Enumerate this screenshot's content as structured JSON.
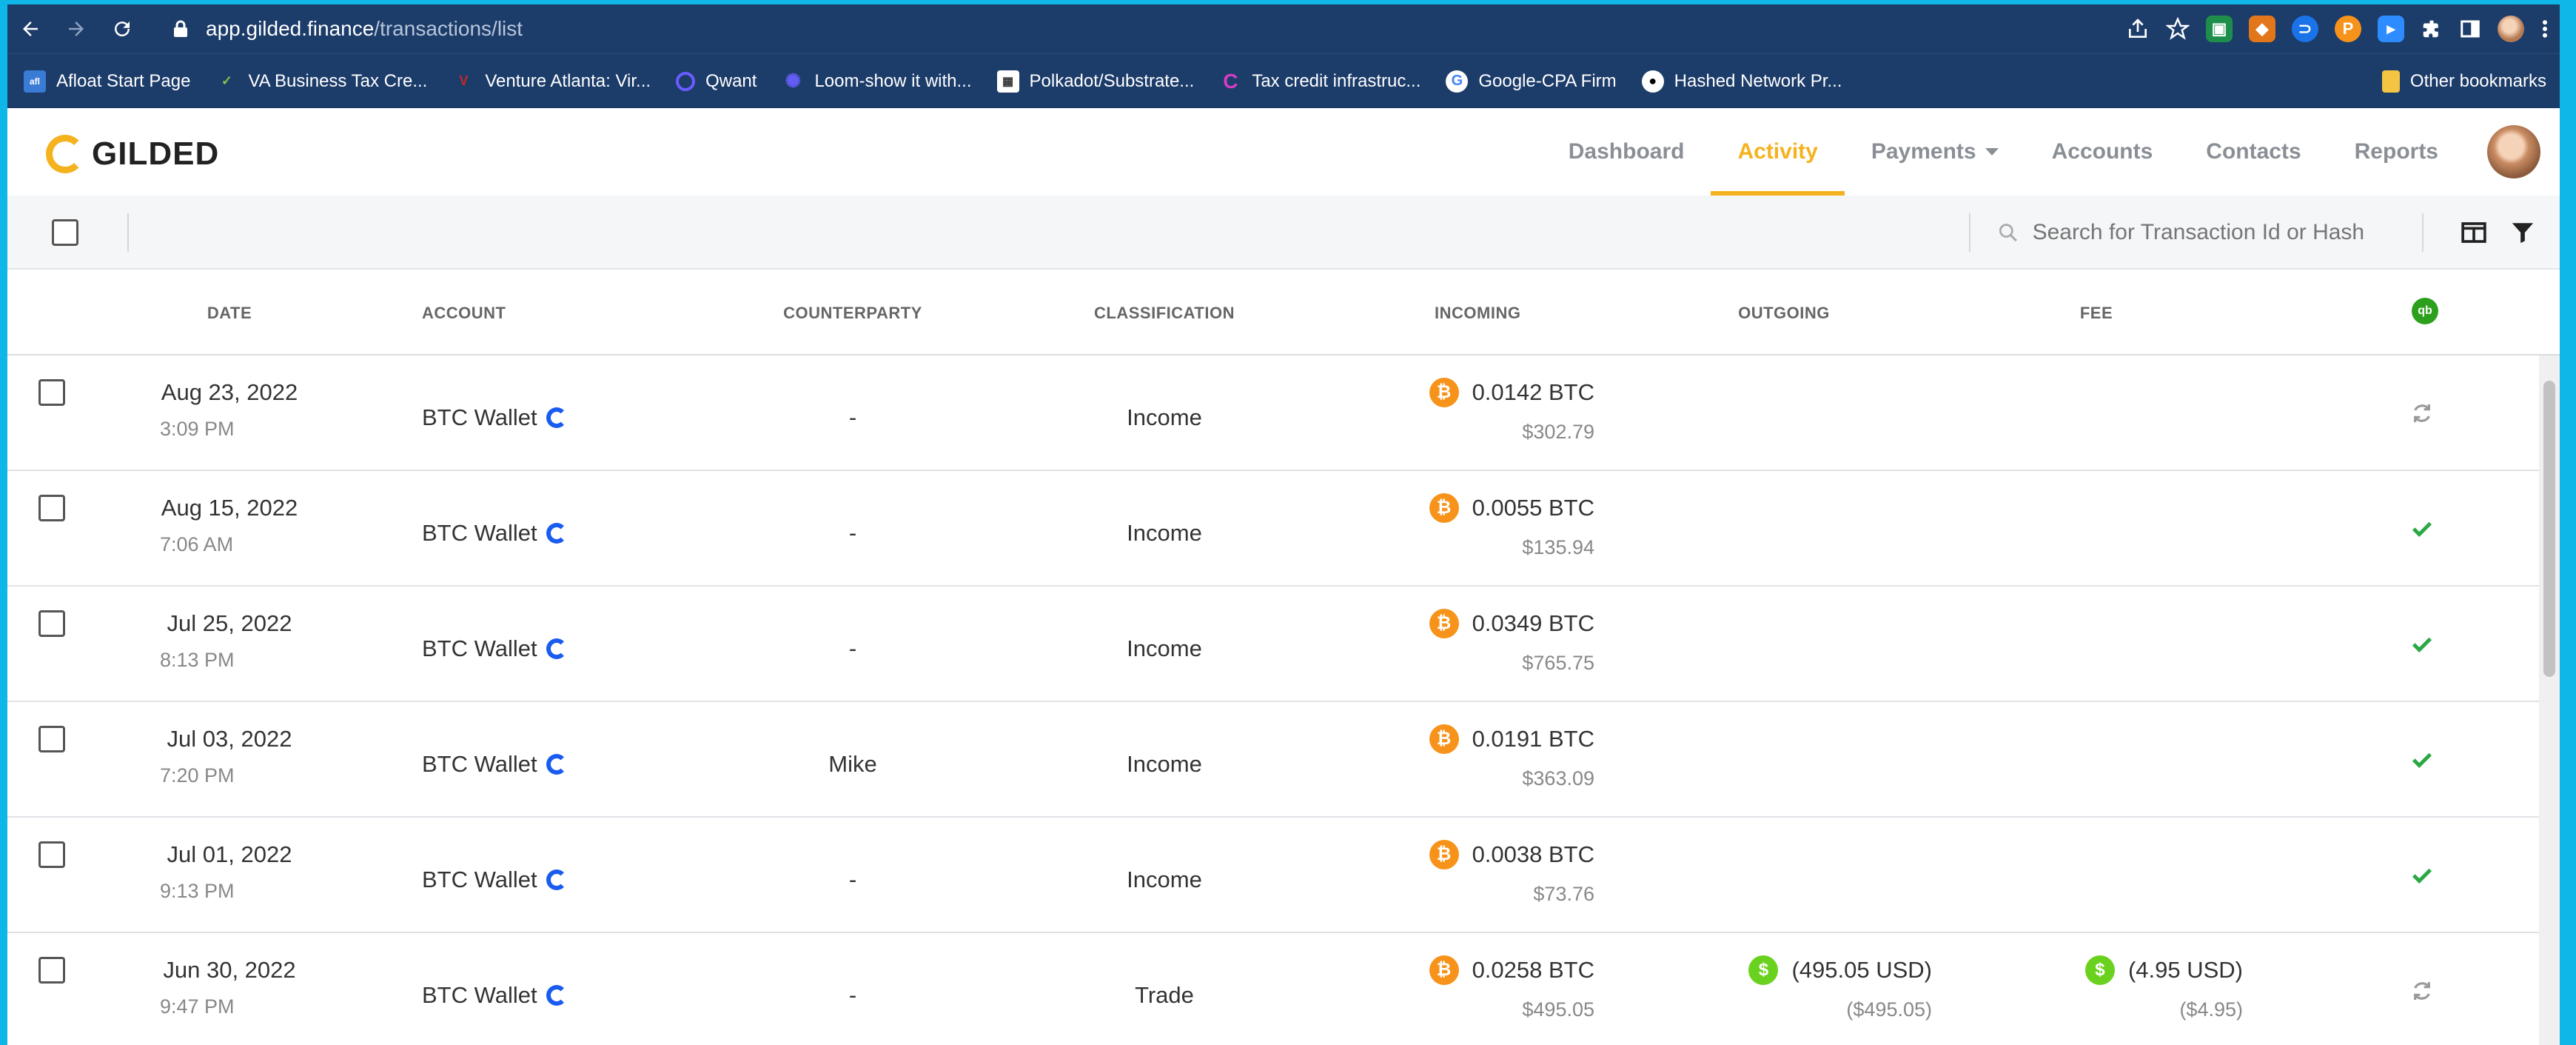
{
  "browser": {
    "url_domain": "app.gilded.finance",
    "url_path": "/transactions/list",
    "bookmarks": [
      {
        "label": "Afloat Start Page",
        "icon": "afloat-icon",
        "color": "#3a7bd5"
      },
      {
        "label": "VA Business Tax Cre...",
        "icon": "va-icon",
        "color": "#8bc34a"
      },
      {
        "label": "Venture Atlanta: Vir...",
        "icon": "venture-atlanta-icon",
        "color": "#c62828"
      },
      {
        "label": "Qwant",
        "icon": "qwant-icon",
        "color": "#6a5cff"
      },
      {
        "label": "Loom-show it with...",
        "icon": "loom-icon",
        "color": "#625df5"
      },
      {
        "label": "Polkadot/Substrate...",
        "icon": "polkadot-icon",
        "color": "#e6007a"
      },
      {
        "label": "Tax credit infrastruc...",
        "icon": "tax-credit-icon",
        "color": "#d63cc4"
      },
      {
        "label": "Google-CPA Firm",
        "icon": "google-icon",
        "color": "#4285f4"
      },
      {
        "label": "Hashed Network Pr...",
        "icon": "github-icon",
        "color": "#ffffff"
      }
    ],
    "other_bookmarks": "Other bookmarks"
  },
  "app": {
    "logo_text": "GILDED",
    "nav": {
      "dashboard": "Dashboard",
      "activity": "Activity",
      "payments": "Payments",
      "accounts": "Accounts",
      "contacts": "Contacts",
      "reports": "Reports"
    },
    "accent_color": "#f4b21e"
  },
  "toolbar": {
    "search_placeholder": "Search for Transaction Id or Hash"
  },
  "table": {
    "headers": {
      "date": "DATE",
      "account": "ACCOUNT",
      "counterparty": "COUNTERPARTY",
      "classification": "CLASSIFICATION",
      "incoming": "INCOMING",
      "outgoing": "OUTGOING",
      "fee": "FEE",
      "qb": "qb"
    },
    "rows": [
      {
        "date": "Aug 23, 2022",
        "time": "3:09 PM",
        "account": "BTC Wallet",
        "counterparty": "-",
        "classification": "Income",
        "incoming": "0.0142 BTC",
        "incoming_usd": "$302.79",
        "outgoing": "",
        "outgoing_usd": "",
        "fee": "",
        "fee_usd": "",
        "status": "sync"
      },
      {
        "date": "Aug 15, 2022",
        "time": "7:06 AM",
        "account": "BTC Wallet",
        "counterparty": "-",
        "classification": "Income",
        "incoming": "0.0055 BTC",
        "incoming_usd": "$135.94",
        "outgoing": "",
        "outgoing_usd": "",
        "fee": "",
        "fee_usd": "",
        "status": "check"
      },
      {
        "date": "Jul 25, 2022",
        "time": "8:13 PM",
        "account": "BTC Wallet",
        "counterparty": "-",
        "classification": "Income",
        "incoming": "0.0349 BTC",
        "incoming_usd": "$765.75",
        "outgoing": "",
        "outgoing_usd": "",
        "fee": "",
        "fee_usd": "",
        "status": "check"
      },
      {
        "date": "Jul 03, 2022",
        "time": "7:20 PM",
        "account": "BTC Wallet",
        "counterparty": "Mike",
        "classification": "Income",
        "incoming": "0.0191 BTC",
        "incoming_usd": "$363.09",
        "outgoing": "",
        "outgoing_usd": "",
        "fee": "",
        "fee_usd": "",
        "status": "check"
      },
      {
        "date": "Jul 01, 2022",
        "time": "9:13 PM",
        "account": "BTC Wallet",
        "counterparty": "-",
        "classification": "Income",
        "incoming": "0.0038 BTC",
        "incoming_usd": "$73.76",
        "outgoing": "",
        "outgoing_usd": "",
        "fee": "",
        "fee_usd": "",
        "status": "check"
      },
      {
        "date": "Jun 30, 2022",
        "time": "9:47 PM",
        "account": "BTC Wallet",
        "counterparty": "-",
        "classification": "Trade",
        "incoming": "0.0258 BTC",
        "incoming_usd": "$495.05",
        "outgoing": "(495.05 USD)",
        "outgoing_usd": "($495.05)",
        "fee": "(4.95 USD)",
        "fee_usd": "($4.95)",
        "status": "sync"
      }
    ]
  },
  "colors": {
    "btc": "#f7931a",
    "usd": "#6ad21f",
    "check": "#2aa845",
    "sync_blue": "#1a5cf0"
  }
}
